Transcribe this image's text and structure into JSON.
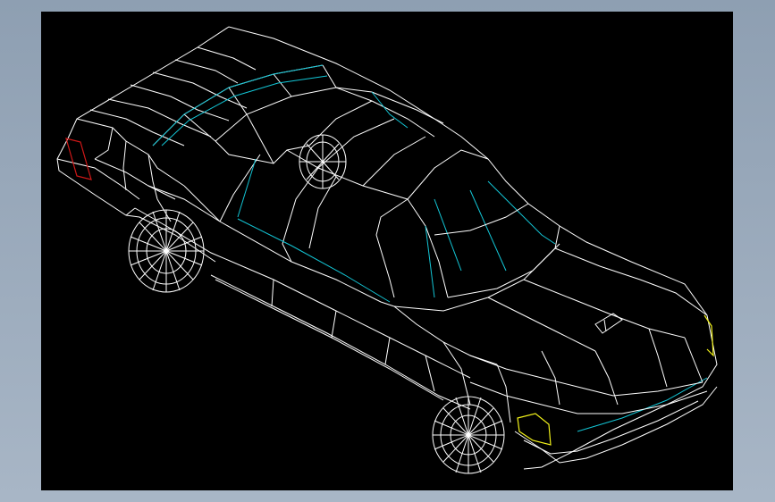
{
  "drawing": {
    "subject": "car-wireframe-isometric",
    "background": "#000000",
    "frame_background": "#9aaabb",
    "colors": {
      "edges": "#ffffff",
      "glass_edges": "#13c6d6",
      "taillight": "#d01818",
      "headlight": "#f2f21a"
    }
  }
}
